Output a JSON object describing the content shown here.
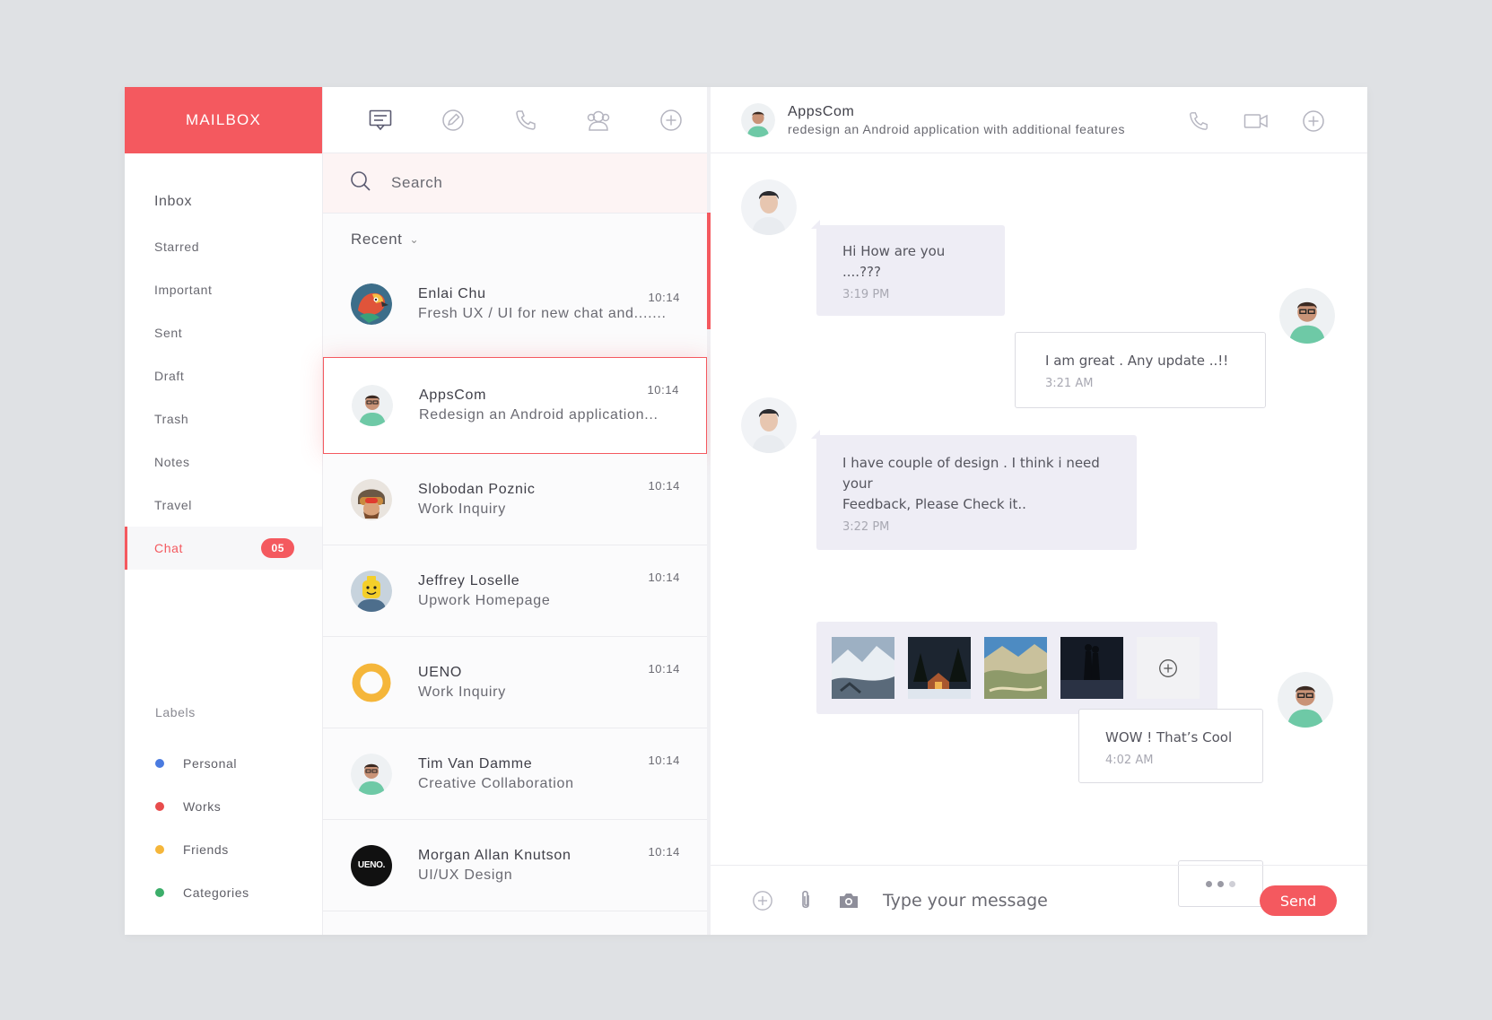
{
  "app": {
    "brand": "MAILBOX"
  },
  "sidebar": {
    "items": [
      {
        "label": "Inbox"
      },
      {
        "label": "Starred"
      },
      {
        "label": "Important"
      },
      {
        "label": "Sent"
      },
      {
        "label": "Draft"
      },
      {
        "label": "Trash"
      },
      {
        "label": "Notes"
      },
      {
        "label": "Travel"
      },
      {
        "label": "Chat",
        "badge": "05"
      }
    ],
    "labels_title": "Labels",
    "labels": [
      {
        "label": "Personal",
        "color": "#4a7be0"
      },
      {
        "label": "Works",
        "color": "#e84c4c"
      },
      {
        "label": "Friends",
        "color": "#f5b63a"
      },
      {
        "label": "Categories",
        "color": "#3cae6a"
      }
    ]
  },
  "toolbar": {
    "icons": [
      "chat-icon",
      "compose-icon",
      "phone-icon",
      "contacts-icon",
      "add-icon"
    ]
  },
  "search": {
    "placeholder": "Search"
  },
  "list": {
    "recent_label": "Recent",
    "contacts": [
      {
        "name": "Enlai Chu",
        "message": "Fresh UX / UI for new chat and.......",
        "time": "10:14",
        "avatar": "parrot-avatar"
      },
      {
        "name": "AppsCom",
        "message": "Redesign an Android application...",
        "time": "10:14",
        "avatar": "man-glasses-avatar",
        "selected": true
      },
      {
        "name": "Slobodan Poznic",
        "message": "Work Inquiry",
        "time": "10:14",
        "avatar": "helmet-avatar"
      },
      {
        "name": "Jeffrey Loselle",
        "message": "Upwork Homepage",
        "time": "10:14",
        "avatar": "lego-avatar"
      },
      {
        "name": "UENO",
        "message": "Work Inquiry",
        "time": "10:14",
        "avatar": "ring-avatar"
      },
      {
        "name": "Tim Van Damme",
        "message": "Creative Collaboration",
        "time": "10:14",
        "avatar": "man-glasses-avatar"
      },
      {
        "name": "Morgan Allan Knutson",
        "message": "UI/UX Design",
        "time": "10:14",
        "avatar": "ueno-logo-avatar",
        "logo_text": "UENO."
      }
    ]
  },
  "chat": {
    "header": {
      "name": "AppsCom",
      "subtitle": "redesign an Android application with additional features"
    },
    "messages": [
      {
        "direction": "in",
        "text": "Hi How are you ....???",
        "time": "3:19 PM"
      },
      {
        "direction": "out",
        "text": "I am great . Any update ..!!",
        "time": "3:21 AM"
      },
      {
        "direction": "in",
        "text_line1": "I have couple of design . I think i need your",
        "text_line2": "Feedback, Please  Check it..",
        "time": "3:22 PM"
      },
      {
        "direction": "out",
        "text": "WOW ! That’s Cool",
        "time": "4:02 AM"
      }
    ],
    "gallery": [
      "snow-landscape-photo",
      "cabin-night-photo",
      "mountain-lake-photo",
      "night-couple-photo"
    ],
    "composer": {
      "placeholder": "Type your message",
      "send_label": "Send"
    }
  },
  "colors": {
    "accent": "#f4595f",
    "bubble_in": "#eeedf5"
  }
}
